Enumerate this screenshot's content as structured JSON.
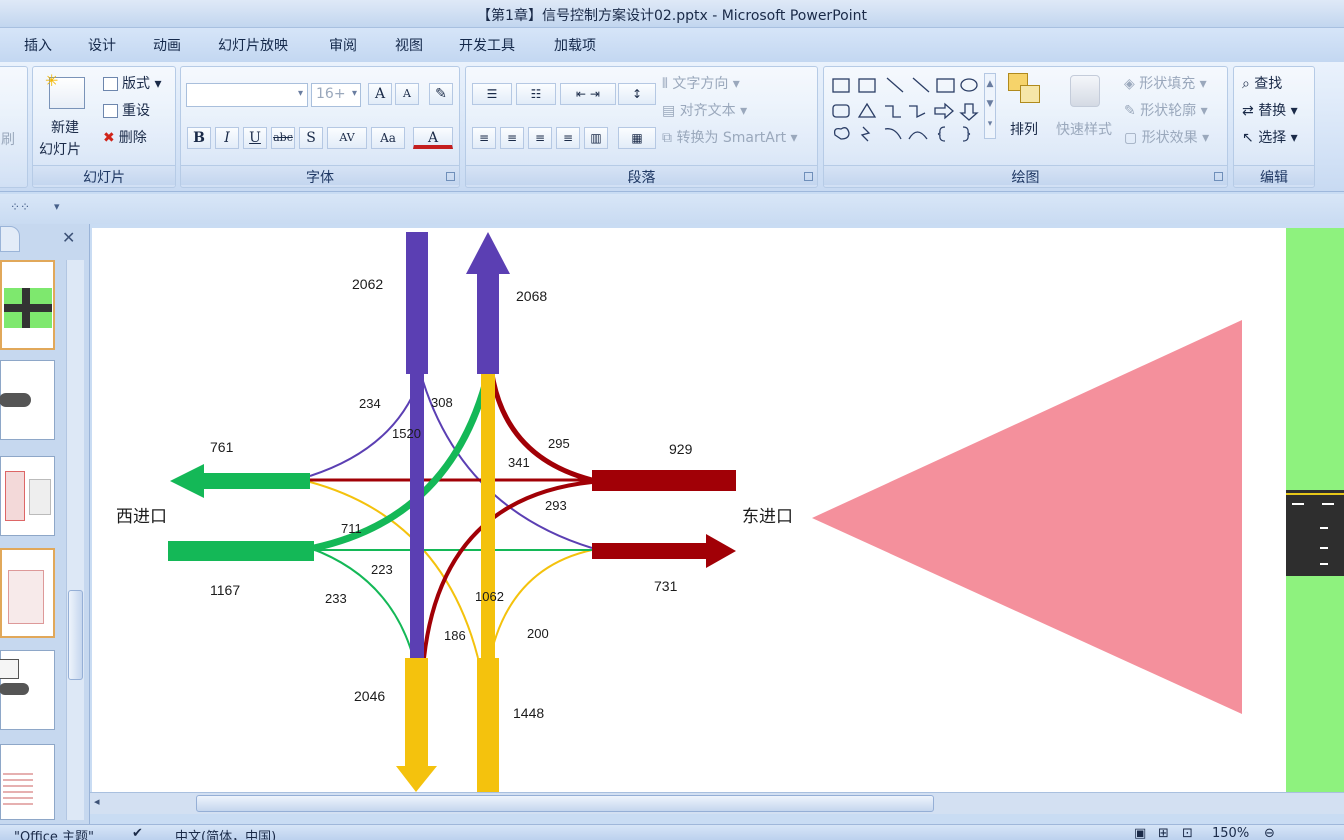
{
  "window": {
    "title": "【第1章】信号控制方案设计02.pptx - Microsoft PowerPoint"
  },
  "tabs": [
    "插入",
    "设计",
    "动画",
    "幻灯片放映",
    "审阅",
    "视图",
    "开发工具",
    "加载项"
  ],
  "ribbon": {
    "clipboard_partial": "刷",
    "slides": {
      "label": "幻灯片",
      "new_slide_line1": "新建",
      "new_slide_line2": "幻灯片",
      "layout": "版式",
      "reset": "重设",
      "delete": "删除"
    },
    "font": {
      "label": "字体",
      "size_value": "16+",
      "bold": "B",
      "italic": "I",
      "underline": "U",
      "strike": "abc",
      "shadow": "S",
      "spacing": "AV",
      "case": "Aa",
      "color": "A",
      "grow": "A",
      "shrink": "A"
    },
    "paragraph": {
      "label": "段落",
      "text_direction": "文字方向",
      "align_text": "对齐文本",
      "convert_smartart": "转换为 SmartArt"
    },
    "drawing": {
      "label": "绘图",
      "arrange": "排列",
      "quick_styles": "快速样式",
      "shape_fill": "形状填充",
      "shape_outline": "形状轮廓",
      "shape_effects": "形状效果"
    },
    "editing": {
      "label": "编辑",
      "find": "查找",
      "replace": "替换",
      "select": "选择"
    }
  },
  "diagram": {
    "west_label": "西进口",
    "east_label": "东进口",
    "flows": {
      "north_out": "2062",
      "north_in": "2068",
      "west_out": "761",
      "west_in": "1167",
      "east_out": "929",
      "east_in": "731",
      "south_out": "2046",
      "south_in": "1448",
      "n_to_w": "234",
      "n_to_e": "308",
      "n_through": "1520",
      "s_from_e": "295",
      "e_to_w": "341",
      "w_to_e_up": "293",
      "w_to_n": "711",
      "w_to_e": "223",
      "w_to_s": "233",
      "s_through": "1062",
      "s_to_w": "186",
      "s_to_e": "200"
    },
    "colors": {
      "north": "#5b3fb3",
      "west": "#14b857",
      "east": "#a10006",
      "south": "#f4c20d",
      "triangle": "#f4909c",
      "green_panel": "#8ef27e"
    }
  },
  "status": {
    "theme": "\"Office 主题\"",
    "language": "中文(简体，中国)",
    "zoom": "150%"
  }
}
